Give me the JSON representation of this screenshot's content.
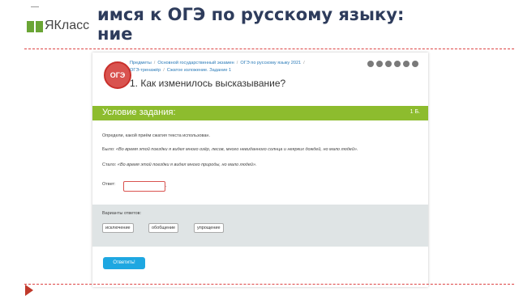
{
  "slide": {
    "title_line1": "имся к ОГЭ по русскому языку:",
    "title_line2": "ние",
    "logo_text": "ЯКласс",
    "accent_color": "#c0392b"
  },
  "task": {
    "badge": "ОГЭ",
    "breadcrumbs": [
      "Предметы",
      "Основной государственный экзамен",
      "ОГЭ по русскому языку 2021",
      "ОГЭ-тренажёр",
      "Сжатое изложение. Задание 1"
    ],
    "title": "1. Как изменилось высказывание?",
    "share_icons": [
      "facebook-icon",
      "odnoklassniki-icon",
      "mail-icon",
      "vk-icon",
      "twitter-icon",
      "flag-icon"
    ]
  },
  "condition": {
    "label": "Условие задания:",
    "points": "1 Б.",
    "bar_color": "#8dbc2e",
    "prompt": "Определи, какой приём сжатия текста использован.",
    "was_label": "Было:",
    "was_text": "«Во время этой поездки я видел много озёр, лесов, много невиданного солнца и неярких дождей, но мало людей».",
    "now_label": "Стало:",
    "now_text": "«Во время этой поездки я видел много природы, но мало людей».",
    "answer_label": "Ответ:",
    "answer_value": "",
    "answer_trailing": "."
  },
  "variants": {
    "label": "Варианты ответов:",
    "options": [
      "исключение",
      "обобщение",
      "упрощение"
    ]
  },
  "submit_label": "Ответить!"
}
